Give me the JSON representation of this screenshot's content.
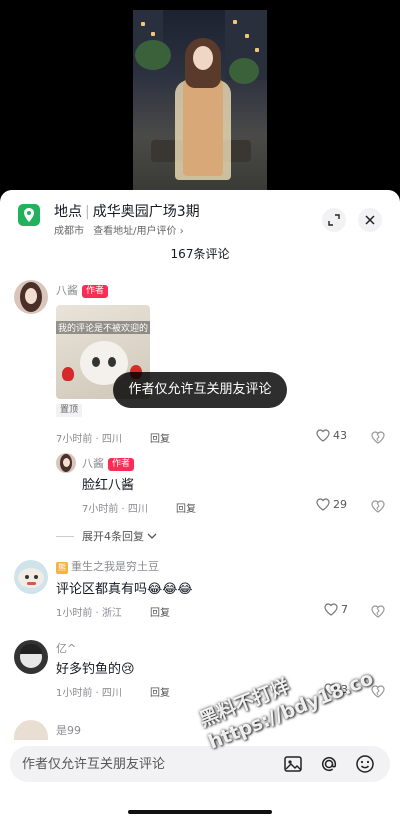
{
  "location": {
    "title_prefix": "地点",
    "title_name": "成华奥园广场3期",
    "city": "成都市",
    "links": "查看地址/用户评价",
    "chevron": "›"
  },
  "comment_count": "167条评论",
  "comments": [
    {
      "username": "八酱",
      "badge": "作者",
      "meme_caption": "我的评论是不被欢迎的",
      "pinned": "置顶",
      "time_location": "7小时前 · 四川",
      "reply_label": "回复",
      "likes": "43"
    },
    {
      "username": "八酱",
      "badge": "作者",
      "text": "脸红八酱",
      "time_location": "7小时前 · 四川",
      "reply_label": "回复",
      "likes": "29"
    },
    {
      "username_icon": "熊",
      "username": "重生之我是穷土豆",
      "text": "评论区都真有吗😂😂😂",
      "time_location": "1小时前 · 浙江",
      "reply_label": "回复",
      "likes": "7"
    },
    {
      "username": "亿^",
      "text": "好多钓鱼的😢",
      "time_location": "1小时前 · 四川",
      "reply_label": "回复",
      "likes": "3"
    },
    {
      "username": "是99"
    }
  ],
  "expand_replies": "展开4条回复",
  "toast": "作者仅允许互关朋友评论",
  "composer": {
    "placeholder": "作者仅允许互关朋友评论"
  },
  "watermark": {
    "line1": "黑料不打烊",
    "line2": "https://bdy18.co"
  },
  "icons": {
    "location": "location-pin-icon",
    "expand": "expand-icon",
    "close": "close-icon",
    "like": "heart-icon",
    "dislike": "dislike-icon",
    "image": "image-icon",
    "mention": "at-icon",
    "emoji": "emoji-icon"
  },
  "colors": {
    "accent": "#fe2c55",
    "location_green": "#22b25d"
  }
}
